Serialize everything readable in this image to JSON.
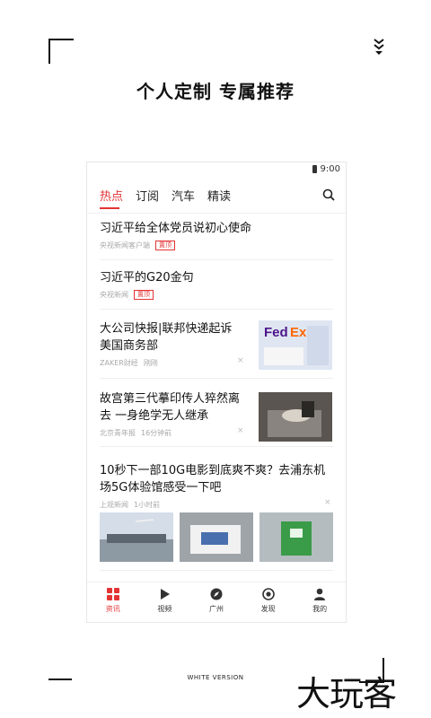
{
  "headline": "个人定制  专属推荐",
  "phone": {
    "status": {
      "time": "9:00"
    },
    "tabs": [
      "热点",
      "订阅",
      "汽车",
      "精读"
    ],
    "active_tab": 0,
    "news": [
      {
        "title": "习近平给全体党员说初心使命",
        "source": "央视新闻客户端",
        "tag": "置顶"
      },
      {
        "title": "习近平的G20金句",
        "source": "央视新闻",
        "tag": "置顶"
      },
      {
        "title": "大公司快报|联邦快递起诉美国商务部",
        "source": "ZAKER财经",
        "time": "刚刚"
      },
      {
        "title": "故宫第三代摹印传人猝然离去 一身绝学无人继承",
        "source": "北京青年报",
        "time": "16分钟前"
      },
      {
        "title": "10秒下一部10G电影到底爽不爽？去浦东机场5G体验馆感受一下吧",
        "source": "上观新闻",
        "time": "1小时前"
      }
    ],
    "close_glyph": "×",
    "bottom_nav": [
      {
        "label": "资讯",
        "icon": "grid-icon"
      },
      {
        "label": "视频",
        "icon": "play-icon"
      },
      {
        "label": "广州",
        "icon": "compass-icon"
      },
      {
        "label": "发现",
        "icon": "target-icon"
      },
      {
        "label": "我的",
        "icon": "user-icon"
      }
    ]
  },
  "footer": {
    "label": "WHITE VERSION"
  },
  "brand": "大玩客",
  "colors": {
    "accent": "#e33333"
  }
}
